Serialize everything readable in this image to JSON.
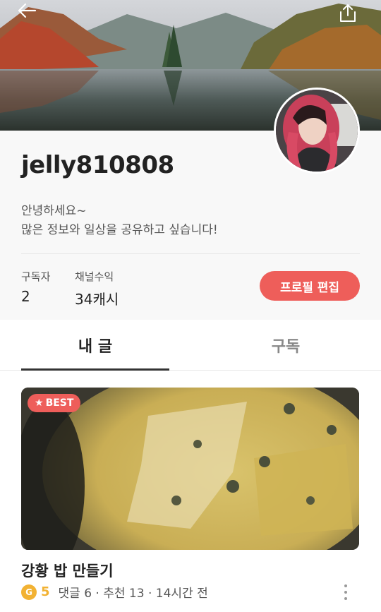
{
  "profile": {
    "username": "jelly810808",
    "bio_line1": "안녕하세요~",
    "bio_line2": "많은 정보와 일상을 공유하고 싶습니다!",
    "stats": [
      {
        "label": "구독자",
        "value": "2"
      },
      {
        "label": "채널수익",
        "value": "34캐시"
      }
    ],
    "edit_button": "프로필 편집"
  },
  "tabs": [
    {
      "label": "내 글",
      "active": true
    },
    {
      "label": "구독",
      "active": false
    }
  ],
  "post": {
    "badge": "BEST",
    "title": "강황 밥 만들기",
    "level_icon": "G",
    "level": "5",
    "meta": "댓글 6 · 추천 13 · 14시간 전"
  },
  "icons": {
    "back": "arrow-left-icon",
    "share": "share-icon",
    "more": "more-vertical-icon",
    "star": "star-icon"
  },
  "colors": {
    "accent": "#ee5e5a",
    "level": "#f2b233"
  }
}
